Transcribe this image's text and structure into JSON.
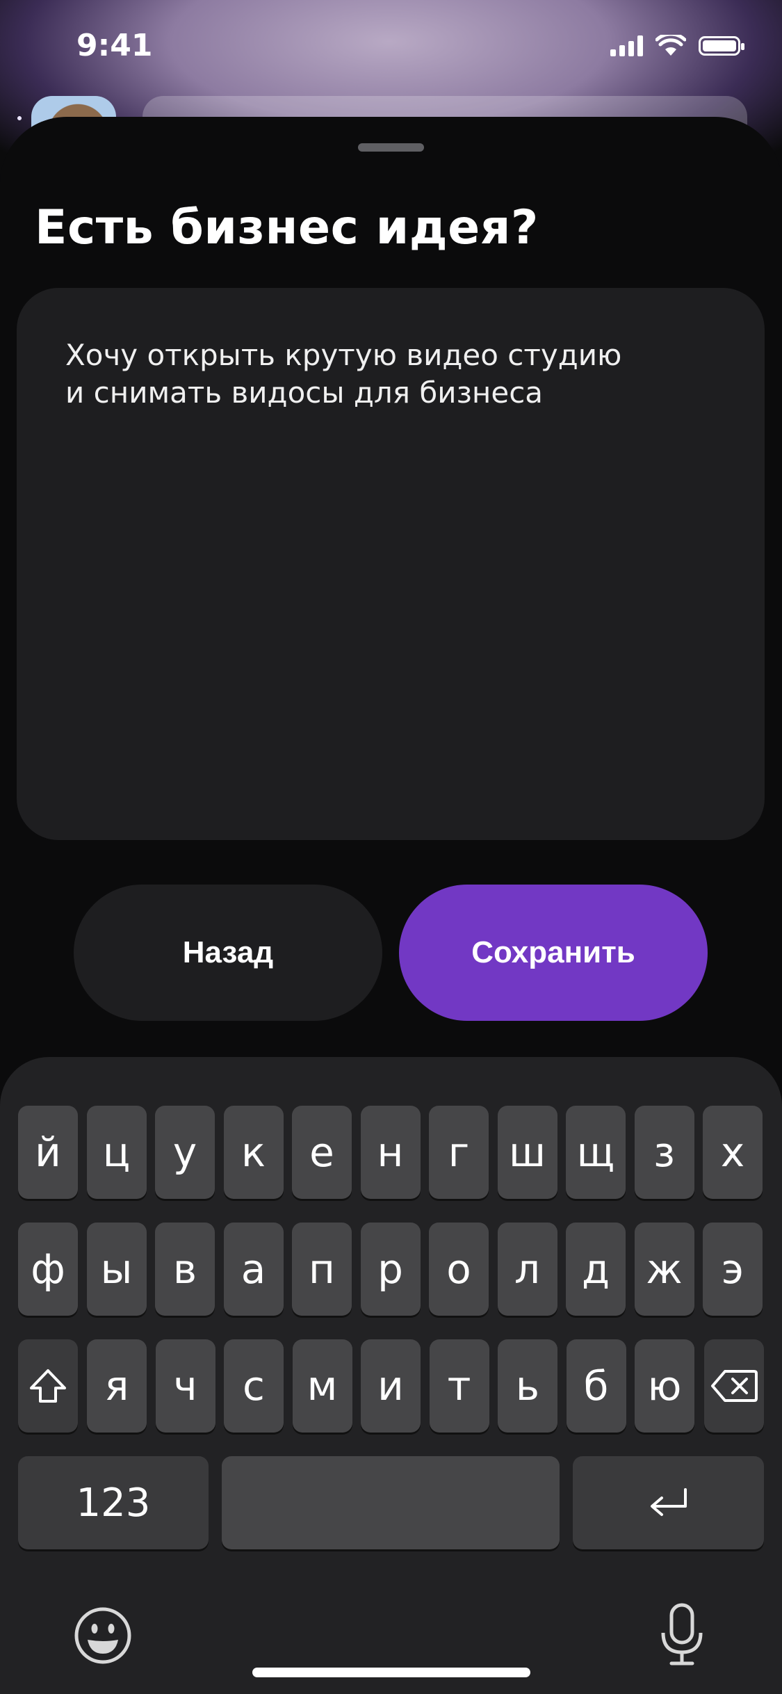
{
  "status_bar": {
    "time": "9:41"
  },
  "sheet": {
    "title": "Есть бизнес идея?",
    "idea_text_line1": "Хочу открыть крутую видео студию",
    "idea_text_line2": "и снимать видосы для бизнеса"
  },
  "buttons": {
    "back_label": "Назад",
    "save_label": "Сохранить"
  },
  "keyboard": {
    "row1": [
      "й",
      "ц",
      "у",
      "к",
      "е",
      "н",
      "г",
      "ш",
      "щ",
      "з",
      "х"
    ],
    "row2": [
      "ф",
      "ы",
      "в",
      "а",
      "п",
      "р",
      "о",
      "л",
      "д",
      "ж",
      "э"
    ],
    "row3": [
      "я",
      "ч",
      "с",
      "м",
      "и",
      "т",
      "ь",
      "б",
      "ю"
    ],
    "numbers_key": "123",
    "icons": [
      "shift-icon",
      "backspace-icon",
      "return-icon",
      "emoji-icon",
      "microphone-icon"
    ]
  },
  "colors": {
    "accent": "#7238c4",
    "panel": "#1e1e20",
    "background": "#0b0b0c"
  }
}
